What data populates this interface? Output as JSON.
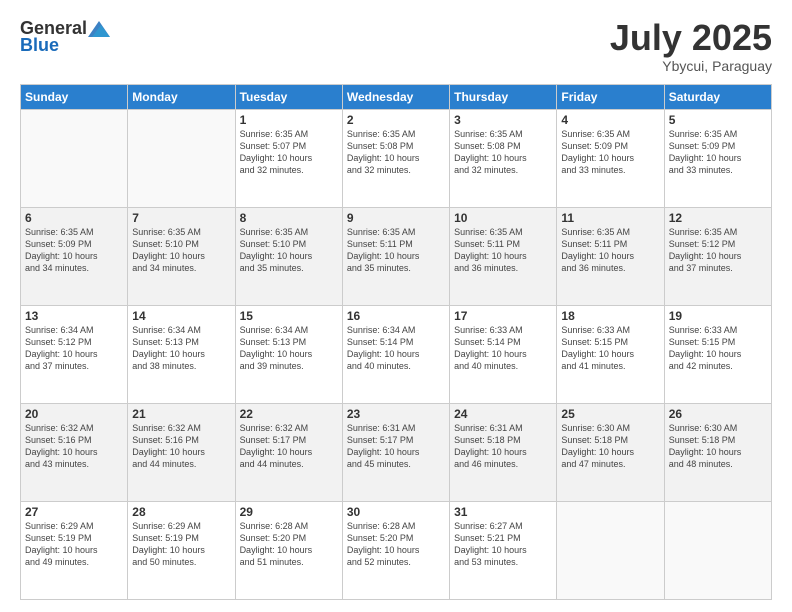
{
  "logo": {
    "general": "General",
    "blue": "Blue"
  },
  "header": {
    "month": "July 2025",
    "location": "Ybycui, Paraguay"
  },
  "days_of_week": [
    "Sunday",
    "Monday",
    "Tuesday",
    "Wednesday",
    "Thursday",
    "Friday",
    "Saturday"
  ],
  "weeks": [
    {
      "shaded": false,
      "days": [
        {
          "num": "",
          "info": ""
        },
        {
          "num": "",
          "info": ""
        },
        {
          "num": "1",
          "info": "Sunrise: 6:35 AM\nSunset: 5:07 PM\nDaylight: 10 hours\nand 32 minutes."
        },
        {
          "num": "2",
          "info": "Sunrise: 6:35 AM\nSunset: 5:08 PM\nDaylight: 10 hours\nand 32 minutes."
        },
        {
          "num": "3",
          "info": "Sunrise: 6:35 AM\nSunset: 5:08 PM\nDaylight: 10 hours\nand 32 minutes."
        },
        {
          "num": "4",
          "info": "Sunrise: 6:35 AM\nSunset: 5:09 PM\nDaylight: 10 hours\nand 33 minutes."
        },
        {
          "num": "5",
          "info": "Sunrise: 6:35 AM\nSunset: 5:09 PM\nDaylight: 10 hours\nand 33 minutes."
        }
      ]
    },
    {
      "shaded": true,
      "days": [
        {
          "num": "6",
          "info": "Sunrise: 6:35 AM\nSunset: 5:09 PM\nDaylight: 10 hours\nand 34 minutes."
        },
        {
          "num": "7",
          "info": "Sunrise: 6:35 AM\nSunset: 5:10 PM\nDaylight: 10 hours\nand 34 minutes."
        },
        {
          "num": "8",
          "info": "Sunrise: 6:35 AM\nSunset: 5:10 PM\nDaylight: 10 hours\nand 35 minutes."
        },
        {
          "num": "9",
          "info": "Sunrise: 6:35 AM\nSunset: 5:11 PM\nDaylight: 10 hours\nand 35 minutes."
        },
        {
          "num": "10",
          "info": "Sunrise: 6:35 AM\nSunset: 5:11 PM\nDaylight: 10 hours\nand 36 minutes."
        },
        {
          "num": "11",
          "info": "Sunrise: 6:35 AM\nSunset: 5:11 PM\nDaylight: 10 hours\nand 36 minutes."
        },
        {
          "num": "12",
          "info": "Sunrise: 6:35 AM\nSunset: 5:12 PM\nDaylight: 10 hours\nand 37 minutes."
        }
      ]
    },
    {
      "shaded": false,
      "days": [
        {
          "num": "13",
          "info": "Sunrise: 6:34 AM\nSunset: 5:12 PM\nDaylight: 10 hours\nand 37 minutes."
        },
        {
          "num": "14",
          "info": "Sunrise: 6:34 AM\nSunset: 5:13 PM\nDaylight: 10 hours\nand 38 minutes."
        },
        {
          "num": "15",
          "info": "Sunrise: 6:34 AM\nSunset: 5:13 PM\nDaylight: 10 hours\nand 39 minutes."
        },
        {
          "num": "16",
          "info": "Sunrise: 6:34 AM\nSunset: 5:14 PM\nDaylight: 10 hours\nand 40 minutes."
        },
        {
          "num": "17",
          "info": "Sunrise: 6:33 AM\nSunset: 5:14 PM\nDaylight: 10 hours\nand 40 minutes."
        },
        {
          "num": "18",
          "info": "Sunrise: 6:33 AM\nSunset: 5:15 PM\nDaylight: 10 hours\nand 41 minutes."
        },
        {
          "num": "19",
          "info": "Sunrise: 6:33 AM\nSunset: 5:15 PM\nDaylight: 10 hours\nand 42 minutes."
        }
      ]
    },
    {
      "shaded": true,
      "days": [
        {
          "num": "20",
          "info": "Sunrise: 6:32 AM\nSunset: 5:16 PM\nDaylight: 10 hours\nand 43 minutes."
        },
        {
          "num": "21",
          "info": "Sunrise: 6:32 AM\nSunset: 5:16 PM\nDaylight: 10 hours\nand 44 minutes."
        },
        {
          "num": "22",
          "info": "Sunrise: 6:32 AM\nSunset: 5:17 PM\nDaylight: 10 hours\nand 44 minutes."
        },
        {
          "num": "23",
          "info": "Sunrise: 6:31 AM\nSunset: 5:17 PM\nDaylight: 10 hours\nand 45 minutes."
        },
        {
          "num": "24",
          "info": "Sunrise: 6:31 AM\nSunset: 5:18 PM\nDaylight: 10 hours\nand 46 minutes."
        },
        {
          "num": "25",
          "info": "Sunrise: 6:30 AM\nSunset: 5:18 PM\nDaylight: 10 hours\nand 47 minutes."
        },
        {
          "num": "26",
          "info": "Sunrise: 6:30 AM\nSunset: 5:18 PM\nDaylight: 10 hours\nand 48 minutes."
        }
      ]
    },
    {
      "shaded": false,
      "days": [
        {
          "num": "27",
          "info": "Sunrise: 6:29 AM\nSunset: 5:19 PM\nDaylight: 10 hours\nand 49 minutes."
        },
        {
          "num": "28",
          "info": "Sunrise: 6:29 AM\nSunset: 5:19 PM\nDaylight: 10 hours\nand 50 minutes."
        },
        {
          "num": "29",
          "info": "Sunrise: 6:28 AM\nSunset: 5:20 PM\nDaylight: 10 hours\nand 51 minutes."
        },
        {
          "num": "30",
          "info": "Sunrise: 6:28 AM\nSunset: 5:20 PM\nDaylight: 10 hours\nand 52 minutes."
        },
        {
          "num": "31",
          "info": "Sunrise: 6:27 AM\nSunset: 5:21 PM\nDaylight: 10 hours\nand 53 minutes."
        },
        {
          "num": "",
          "info": ""
        },
        {
          "num": "",
          "info": ""
        }
      ]
    }
  ]
}
